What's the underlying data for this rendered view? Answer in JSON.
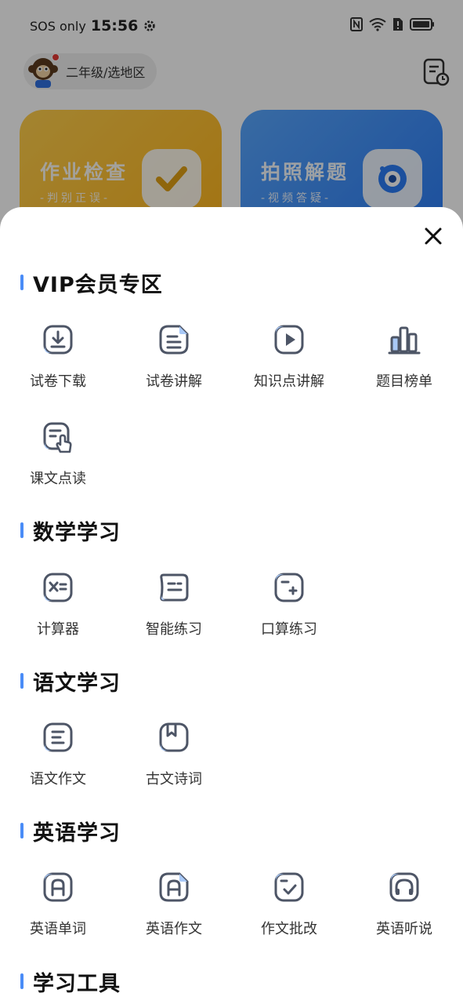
{
  "status_bar": {
    "carrier": "SOS only",
    "time": "15:56"
  },
  "header": {
    "grade_label": "二年级/选地区"
  },
  "cards": [
    {
      "title": "作业检查",
      "subtitle": "-判别正误-"
    },
    {
      "title": "拍照解题",
      "subtitle": "-视频答疑-"
    }
  ],
  "sections": [
    {
      "title": "VIP会员专区",
      "items": [
        {
          "label": "试卷下载",
          "icon": "download-doc-icon"
        },
        {
          "label": "试卷讲解",
          "icon": "paper-explain-icon"
        },
        {
          "label": "知识点讲解",
          "icon": "video-play-icon"
        },
        {
          "label": "题目榜单",
          "icon": "bar-chart-icon"
        },
        {
          "label": "课文点读",
          "icon": "point-read-icon"
        }
      ]
    },
    {
      "title": "数学学习",
      "items": [
        {
          "label": "计算器",
          "icon": "calculator-icon"
        },
        {
          "label": "智能练习",
          "icon": "smart-practice-icon"
        },
        {
          "label": "口算练习",
          "icon": "mental-math-icon"
        }
      ]
    },
    {
      "title": "语文学习",
      "items": [
        {
          "label": "语文作文",
          "icon": "essay-icon"
        },
        {
          "label": "古文诗词",
          "icon": "bookmark-book-icon"
        }
      ]
    },
    {
      "title": "英语学习",
      "items": [
        {
          "label": "英语单词",
          "icon": "letter-a-icon"
        },
        {
          "label": "英语作文",
          "icon": "letter-a-doc-icon"
        },
        {
          "label": "作文批改",
          "icon": "check-doc-icon"
        },
        {
          "label": "英语听说",
          "icon": "headphones-icon"
        }
      ]
    },
    {
      "title": "学习工具",
      "items": []
    }
  ],
  "colors": {
    "accent": "#4a8cf7",
    "icon_stroke": "#4d5566",
    "icon_fill": "#a9c9f7"
  }
}
